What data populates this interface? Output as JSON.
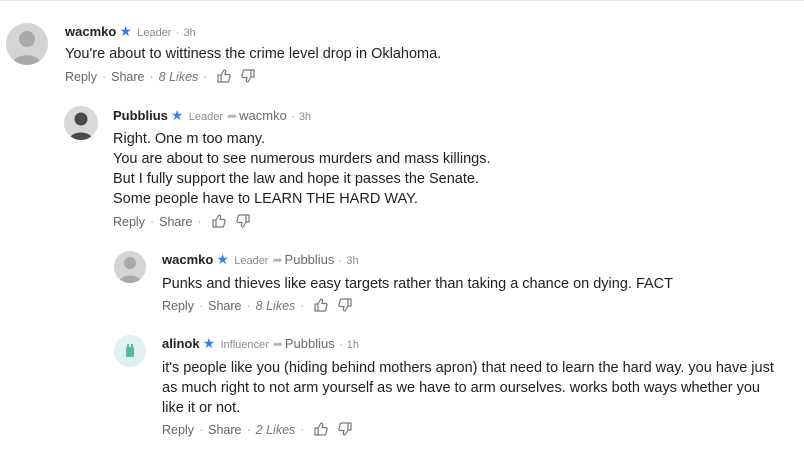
{
  "comments": [
    {
      "username": "wacmko",
      "badge": "Leader",
      "reply_to": "",
      "time": "3h",
      "avatar": "person-avatar",
      "lines": [
        "You're about to wittiness the crime level drop in Oklahoma."
      ],
      "reply_label": "Reply",
      "share_label": "Share",
      "likes": "8 Likes"
    },
    {
      "username": "Pubblius",
      "badge": "Leader",
      "reply_to": "wacmko",
      "time": "3h",
      "avatar": "person-avatar-dark",
      "lines": [
        "Right. One m too many.",
        "You are about to see numerous murders and mass killings.",
        "But I fully support the law and hope it passes the Senate.",
        "Some people have to LEARN THE HARD WAY."
      ],
      "reply_label": "Reply",
      "share_label": "Share",
      "likes": ""
    },
    {
      "username": "wacmko",
      "badge": "Leader",
      "reply_to": "Pubblius",
      "time": "3h",
      "avatar": "person-avatar",
      "lines": [
        "Punks and thieves like easy targets rather than taking a chance on dying. FACT"
      ],
      "reply_label": "Reply",
      "share_label": "Share",
      "likes": "8 Likes"
    },
    {
      "username": "alinok",
      "badge": "Influencer",
      "reply_to": "Pubblius",
      "time": "1h",
      "avatar": "teal-avatar",
      "lines": [
        "it's people like you (hiding behind mothers apron) that need to learn the hard way. you have just",
        "as much right to not arm yourself as we have to arm ourselves. works both ways whether you",
        "like it or not."
      ],
      "reply_label": "Reply",
      "share_label": "Share",
      "likes": "2 Likes"
    }
  ],
  "icons": {
    "verified": "star-icon",
    "reply_arrow": "reply-arrow-icon",
    "like": "thumbs-up-icon",
    "dislike": "thumbs-down-icon"
  },
  "colors": {
    "star": "#3a7ee6",
    "avatar_gray": "#d7d7d7",
    "avatar_teal": "#dff2ef",
    "text": "#1f1f1f",
    "meta": "#888888"
  }
}
